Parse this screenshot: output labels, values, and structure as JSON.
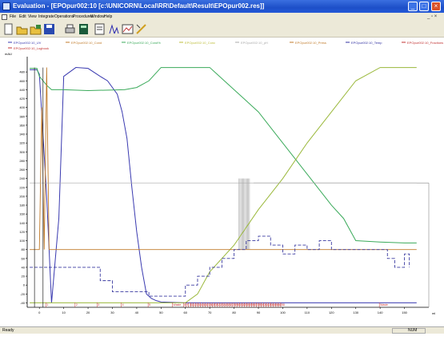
{
  "window": {
    "title": "Evaluation - [EPOpur002:10    [c:\\UNICORN\\Local\\RR\\Default\\Result\\EPOpur002.res]]",
    "min_symbol": "_",
    "max_symbol": "□",
    "close_symbol": "×"
  },
  "menu": {
    "items": [
      "File",
      "Edit",
      "View",
      "Integrate",
      "Operations",
      "Procedures",
      "Window",
      "Help"
    ],
    "mdi_controls": "_ ▫ ×"
  },
  "toolbar": {
    "icons": [
      "new-icon",
      "open-icon",
      "open-result-icon",
      "save-icon",
      "print-icon",
      "calculator-icon",
      "report-icon",
      "integrate-icon",
      "chart-icon",
      "line-icon"
    ]
  },
  "status": {
    "left": "Ready",
    "right": "NUM"
  },
  "colors": {
    "uv": "#3a3ab0",
    "cond": "#c07a2a",
    "concb": "#3aaa5a",
    "conc_line": "#bdbd3a",
    "pressure": "#444488",
    "ph": "#888888",
    "temp": "#3030a0",
    "fractions": "#c03030",
    "title_bar": "#2459d8",
    "chrome": "#ece9d8"
  },
  "chart_data": {
    "type": "line",
    "legend": [
      {
        "name": "EPOpur002:10_UV",
        "color": "#3a3ab0"
      },
      {
        "name": "EPOpur002:10_Cond",
        "color": "#c07a2a"
      },
      {
        "name": "EPOpur002:10_Cond%",
        "color": "#3aaa5a"
      },
      {
        "name": "EPOpur002:10_Conc",
        "color": "#bdbd3a"
      },
      {
        "name": "EPOpur002:10_pH",
        "color": "#aaaaaa"
      },
      {
        "name": "EPOpur002:10_Press",
        "color": "#c07a2a"
      },
      {
        "name": "EPOpur002:10_Temp",
        "color": "#3030a0"
      },
      {
        "name": "EPOpur002:10_Fractions",
        "color": "#c03030"
      },
      {
        "name": "EPOpur002:10_Inject",
        "color": "#c030c0"
      },
      {
        "name": "EPOpur002:10_Logbook",
        "color": "#c03030"
      }
    ],
    "ylabel": "mAU",
    "xlabel": "ml",
    "xlim": [
      -5,
      160
    ],
    "ylim": [
      -50,
      500
    ],
    "yticks": [
      480,
      460,
      440,
      420,
      400,
      380,
      360,
      340,
      320,
      300,
      280,
      260,
      240,
      220,
      200,
      180,
      160,
      140,
      120,
      100,
      80,
      60,
      40,
      20,
      0,
      -20,
      -40
    ],
    "xticks": [
      0,
      10,
      20,
      30,
      40,
      50,
      60,
      70,
      80,
      90,
      100,
      110,
      120,
      130,
      140,
      150
    ],
    "series": [
      {
        "name": "EPOpur002:10_UV",
        "x": [
          -4,
          -1,
          0,
          3,
          5,
          8,
          10,
          15,
          20,
          25,
          28,
          32,
          34,
          36,
          38,
          40,
          42,
          44,
          46,
          48,
          50,
          60,
          70,
          80,
          90,
          100,
          110,
          120,
          130,
          140,
          150,
          155
        ],
        "y": [
          485,
          485,
          475,
          200,
          -40,
          150,
          470,
          490,
          488,
          470,
          460,
          430,
          390,
          330,
          220,
          120,
          40,
          -20,
          -30,
          -35,
          -38,
          -40,
          -40,
          -40,
          -40,
          -40,
          -40,
          -40,
          -40,
          -40,
          -40,
          -40
        ]
      },
      {
        "name": "EPOpur002:10_Cond%",
        "x": [
          -4,
          -1,
          0,
          3,
          5,
          7,
          10,
          20,
          35,
          40,
          45,
          50,
          55,
          60,
          65,
          70,
          72,
          80,
          85,
          90,
          100,
          110,
          120,
          125,
          130,
          140,
          150,
          155
        ],
        "y": [
          488,
          488,
          470,
          450,
          440,
          440,
          440,
          438,
          440,
          445,
          460,
          490,
          490,
          490,
          490,
          490,
          480,
          440,
          415,
          390,
          320,
          250,
          180,
          150,
          100,
          97,
          95,
          95
        ]
      },
      {
        "name": "EPOpur002:10_Conc",
        "x": [
          -4,
          55,
          57,
          60,
          65,
          70,
          80,
          90,
          100,
          110,
          120,
          130,
          140,
          150,
          155
        ],
        "y": [
          -40,
          -40,
          -40,
          -40,
          -20,
          30,
          90,
          170,
          240,
          320,
          390,
          460,
          490,
          490,
          490
        ]
      },
      {
        "name": "EPOpur002:10_Press",
        "x": [
          -4,
          0,
          1,
          2,
          3,
          4,
          5,
          10,
          60,
          100,
          150,
          155
        ],
        "y": [
          80,
          80,
          400,
          80,
          490,
          80,
          80,
          80,
          80,
          80,
          80,
          80
        ]
      },
      {
        "name": "EPOpur002:10_Temp",
        "x": [
          -4,
          10,
          25,
          30,
          40,
          45,
          55,
          60,
          65,
          70,
          75,
          80,
          85,
          90,
          95,
          100,
          105,
          110,
          115,
          120,
          140,
          143,
          146,
          150,
          152
        ],
        "y": [
          40,
          40,
          10,
          -15,
          -15,
          -25,
          -25,
          0,
          20,
          40,
          60,
          80,
          100,
          110,
          90,
          70,
          90,
          80,
          100,
          80,
          80,
          60,
          40,
          70,
          40
        ]
      },
      {
        "name": "EPOpur002:10_pH",
        "x": [
          -4,
          60,
          88,
          90,
          155
        ],
        "y": [
          230,
          230,
          230,
          230,
          230
        ]
      }
    ],
    "fraction_labels": [
      "1",
      "2",
      "3",
      "4",
      "5",
      "Waste",
      "8",
      "9",
      "10",
      "11",
      "12",
      "13",
      "14",
      "15",
      "16",
      "17",
      "18",
      "19",
      "20",
      "21",
      "22",
      "23",
      "24",
      "25",
      "26",
      "27",
      "28",
      "29",
      "30",
      "31",
      "32",
      "33",
      "34",
      "35",
      "36",
      "37",
      "38",
      "39",
      "40",
      "41",
      "42",
      "43",
      "44",
      "45",
      "46",
      "47",
      "48",
      "Waste"
    ],
    "grid": false,
    "legend_position": "top"
  }
}
